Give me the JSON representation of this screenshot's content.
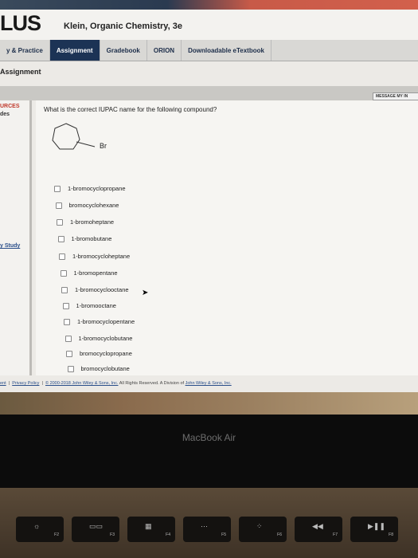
{
  "header": {
    "logo": "LUS",
    "course": "Klein, Organic Chemistry, 3e"
  },
  "nav": {
    "tabs": [
      {
        "label": "y & Practice",
        "active": false
      },
      {
        "label": "Assignment",
        "active": true
      },
      {
        "label": "Gradebook",
        "active": false
      },
      {
        "label": "ORION",
        "active": false
      },
      {
        "label": "Downloadable eTextbook",
        "active": false
      }
    ]
  },
  "breadcrumb": "Assignment",
  "message_button": "MESSAGE MY IN",
  "sidebar": {
    "resources": "URCES",
    "guides": "des",
    "study": "y Study"
  },
  "question": {
    "text": "What is the correct IUPAC name for the following compound?",
    "substituent": "Br",
    "options": [
      "1-bromocyclopropane",
      "bromocyclohexane",
      "1-bromoheptane",
      "1-bromobutane",
      "1-bromocycloheptane",
      "1-bromopentane",
      "1-bromocyclooctane",
      "1-bromooctane",
      "1-bromocyclopentane",
      "1-bromocyclobutane",
      "bromocyclopropane",
      "bromocyclobutane"
    ]
  },
  "footer": {
    "link1": "ent",
    "privacy": "Privacy Policy",
    "copyright": "© 2000-2018 John Wiley & Sons, Inc.",
    "rights": "All Rights Reserved. A Division of",
    "division": "John Wiley & Sons, Inc."
  },
  "device": {
    "brand": "MacBook Air",
    "keys": [
      {
        "glyph": "☼",
        "label": "F2"
      },
      {
        "glyph": "▭▭",
        "label": "F3"
      },
      {
        "glyph": "▦",
        "label": "F4"
      },
      {
        "glyph": "⋯",
        "label": "F5"
      },
      {
        "glyph": "⁘",
        "label": "F6"
      },
      {
        "glyph": "◀◀",
        "label": "F7"
      },
      {
        "glyph": "▶❚❚",
        "label": "F8"
      }
    ]
  }
}
